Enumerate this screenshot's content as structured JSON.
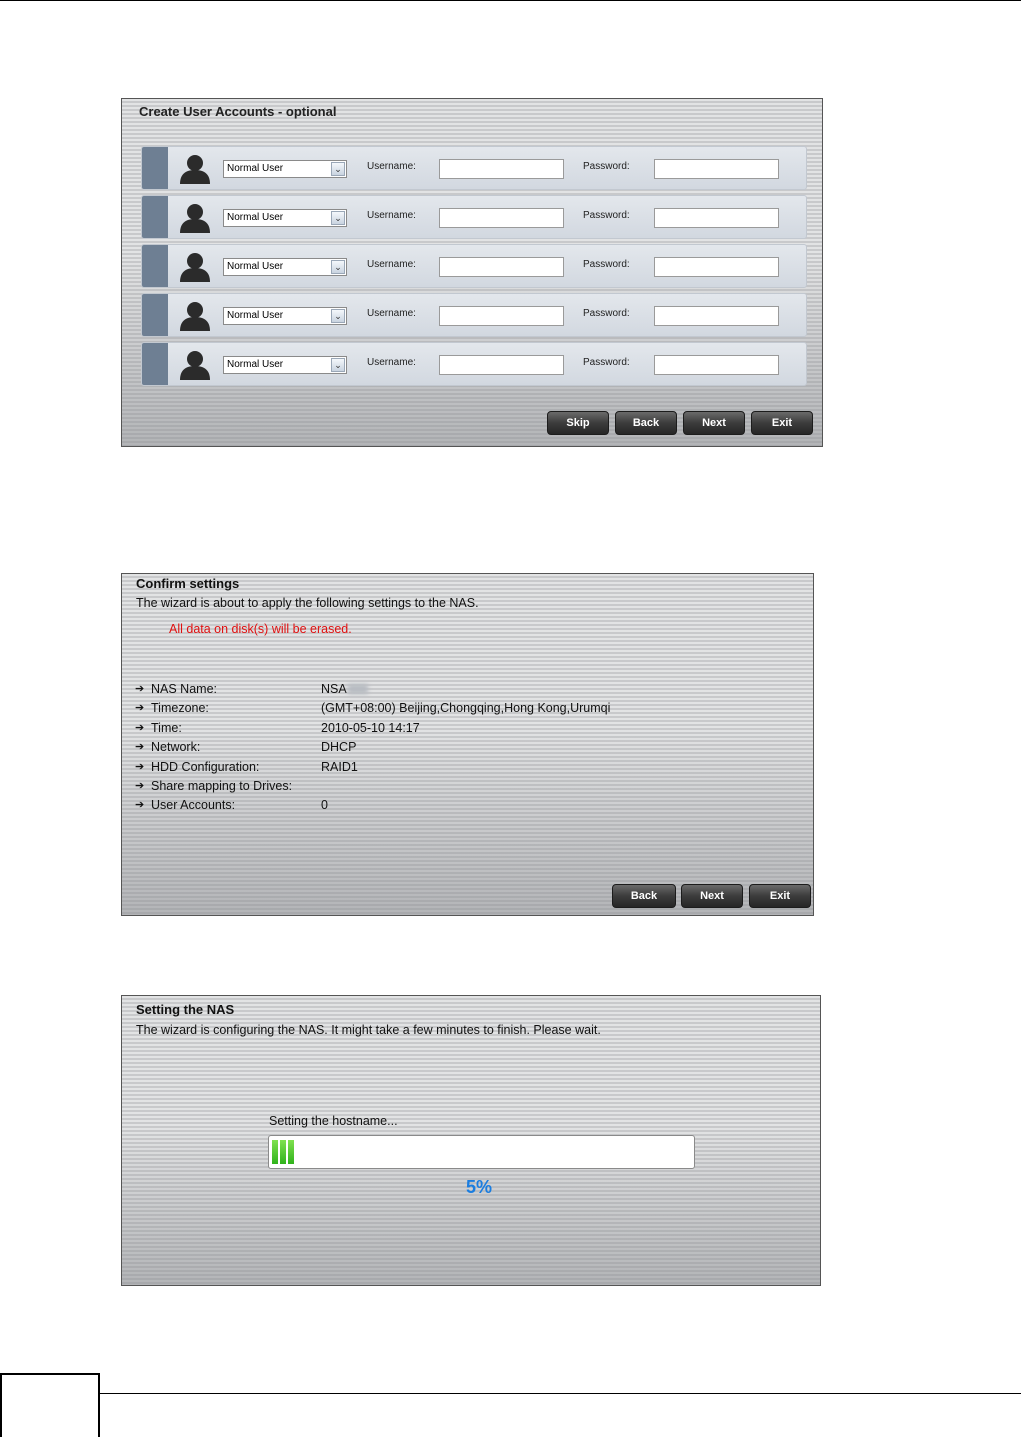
{
  "create_accounts": {
    "title": "Create User Accounts - optional",
    "username_label": "Username:",
    "password_label": "Password:",
    "rows": [
      {
        "role": "Normal User",
        "username": "",
        "password": ""
      },
      {
        "role": "Normal User",
        "username": "",
        "password": ""
      },
      {
        "role": "Normal User",
        "username": "",
        "password": ""
      },
      {
        "role": "Normal User",
        "username": "",
        "password": ""
      },
      {
        "role": "Normal User",
        "username": "",
        "password": ""
      }
    ],
    "buttons": {
      "skip": "Skip",
      "back": "Back",
      "next": "Next",
      "exit": "Exit"
    }
  },
  "confirm": {
    "title": "Confirm settings",
    "description": "The wizard is about to apply the following settings to the NAS.",
    "warning": "All data on disk(s) will be erased.",
    "warning_color": "#e01010",
    "settings": [
      {
        "key": "NAS Name:",
        "value": "NSA"
      },
      {
        "key": "Timezone:",
        "value": "(GMT+08:00) Beijing,Chongqing,Hong Kong,Urumqi"
      },
      {
        "key": "Time:",
        "value": "2010-05-10 14:17"
      },
      {
        "key": "Network:",
        "value": "DHCP"
      },
      {
        "key": "HDD Configuration:",
        "value": "RAID1"
      },
      {
        "key": "Share mapping to Drives:",
        "value": ""
      },
      {
        "key": "User Accounts:",
        "value": "0"
      }
    ],
    "buttons": {
      "back": "Back",
      "next": "Next",
      "exit": "Exit"
    }
  },
  "setting_nas": {
    "title": "Setting the NAS",
    "description": "The wizard is configuring the NAS. It might take a few minutes to finish. Please wait.",
    "status": "Setting the hostname...",
    "progress_percent": 5,
    "progress_label": "5%",
    "progress_color": "#3cc021",
    "percent_color": "#1a7de0"
  }
}
